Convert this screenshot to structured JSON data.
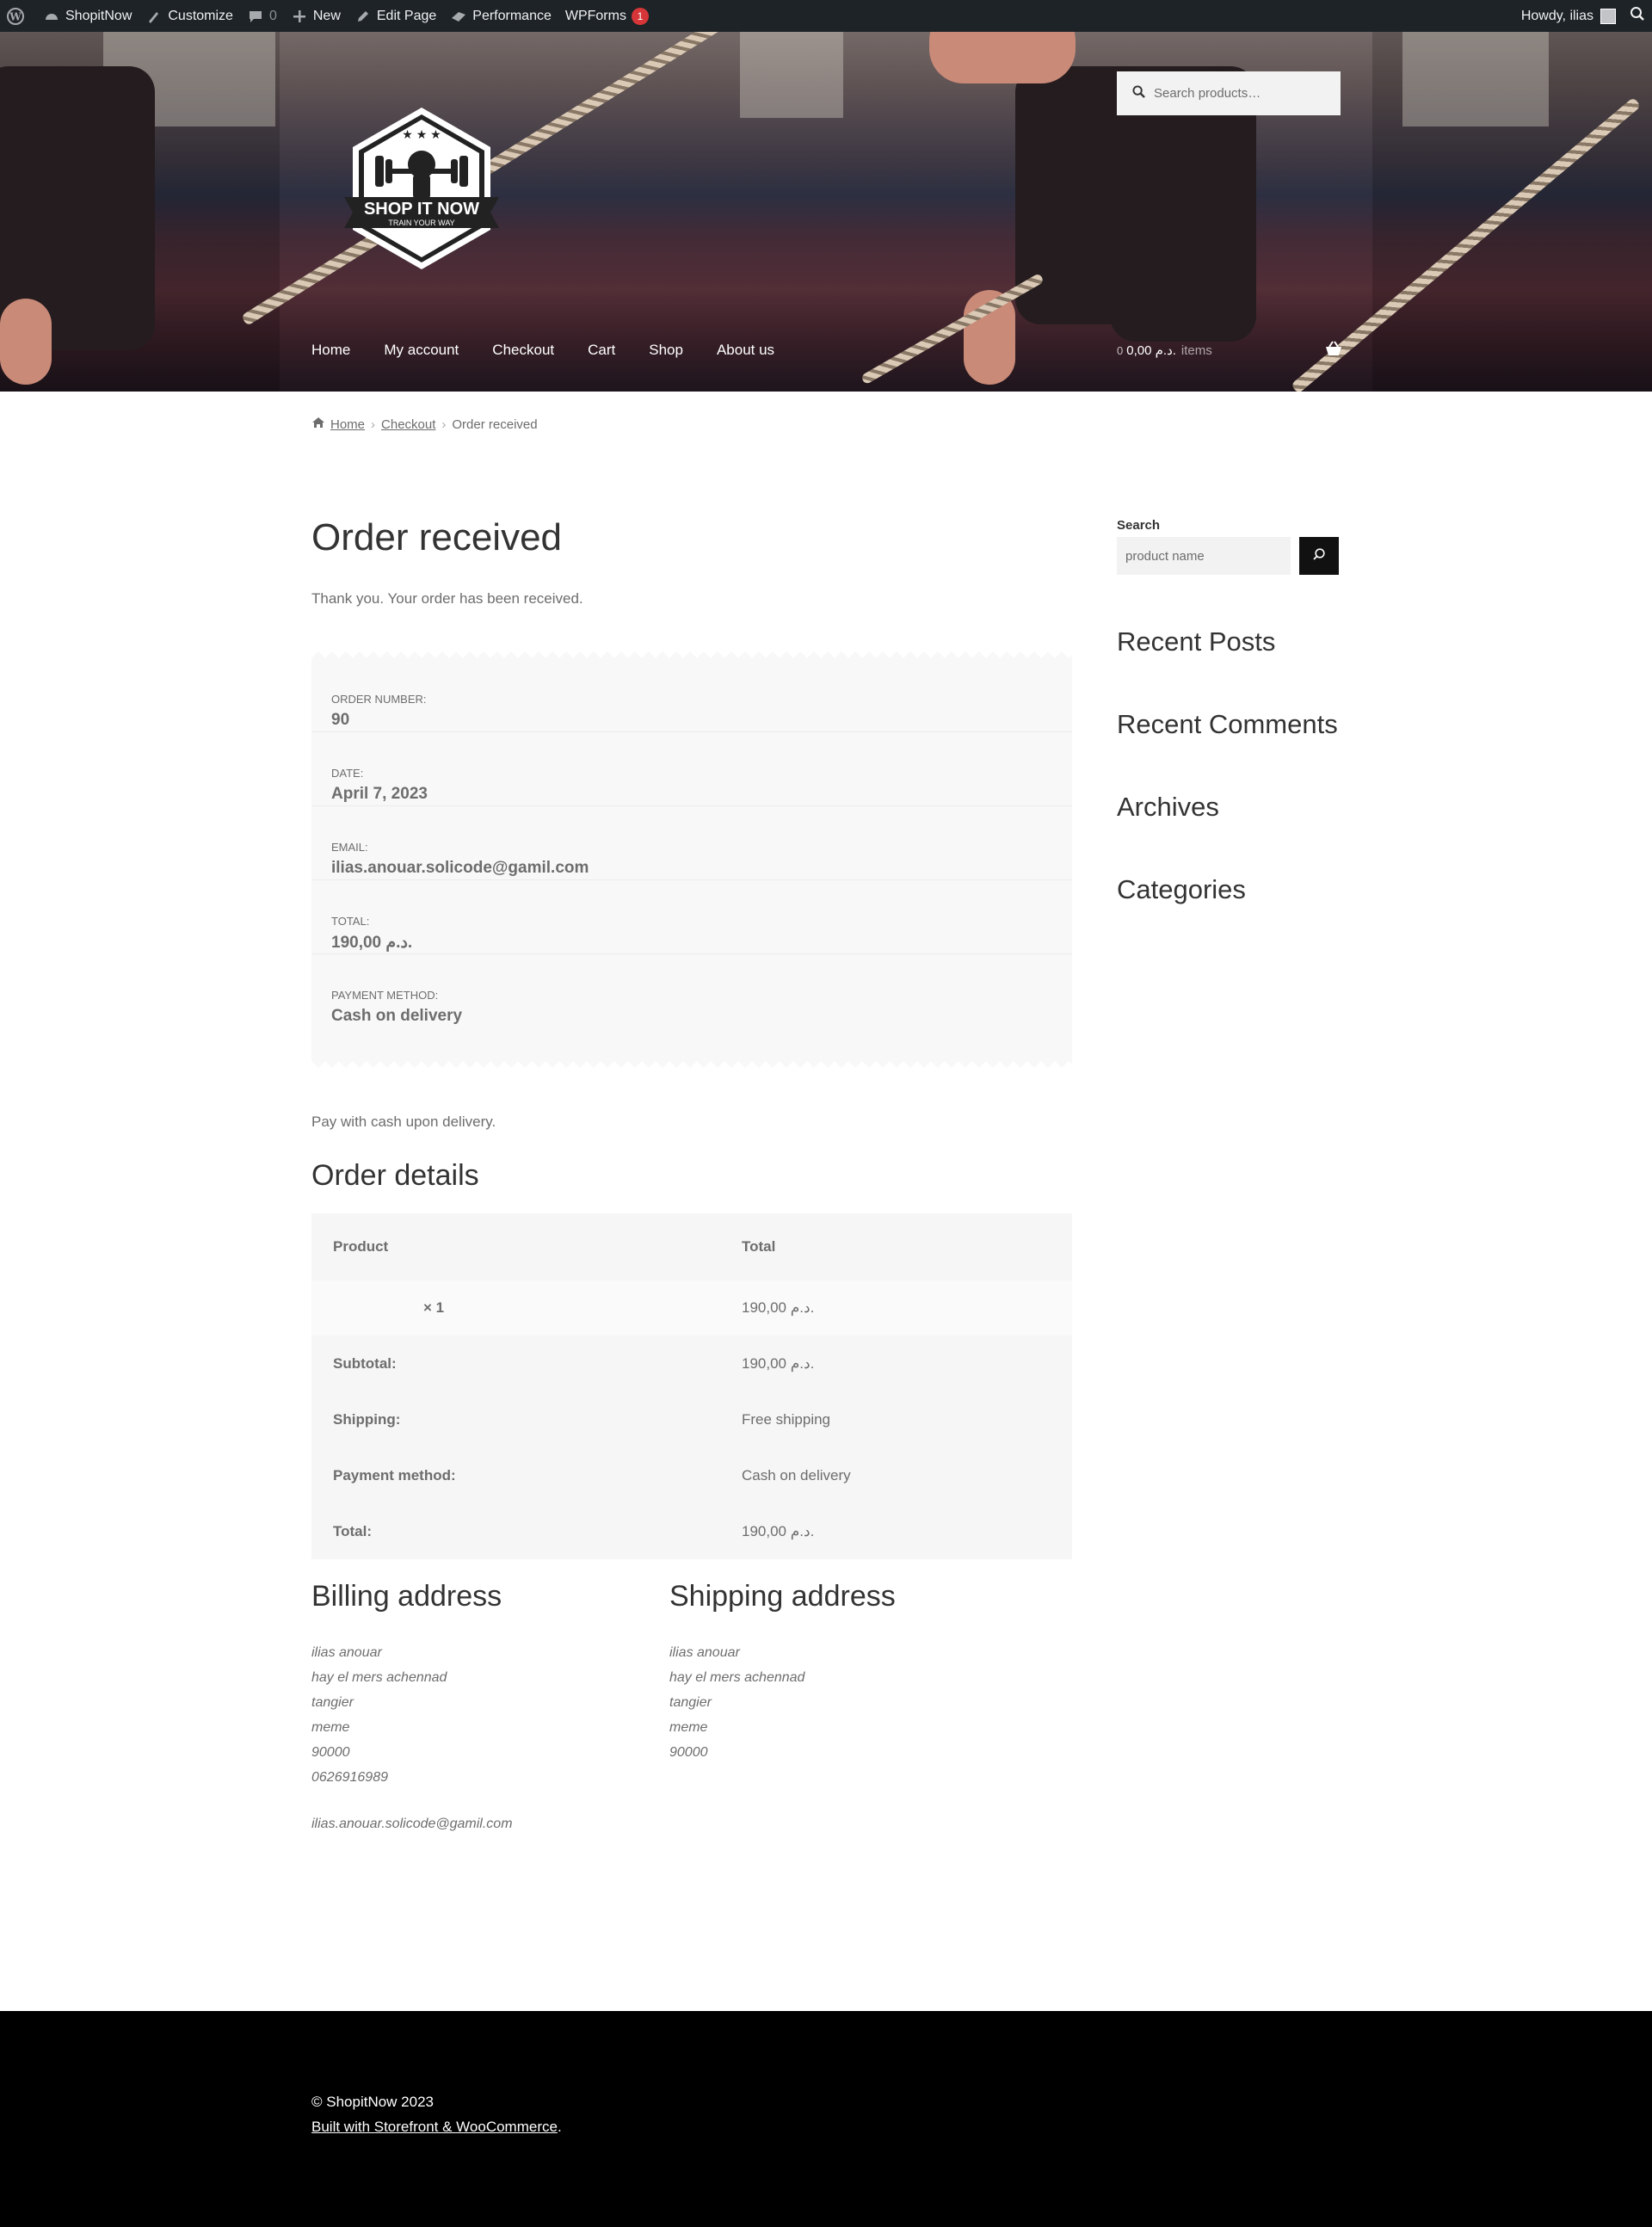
{
  "admin_bar": {
    "site_name": "ShopitNow",
    "customize": "Customize",
    "comments_count": "0",
    "new": "New",
    "edit_page": "Edit Page",
    "performance": "Performance",
    "wpforms": "WPForms",
    "wpforms_badge": "1",
    "howdy": "Howdy, ilias"
  },
  "header": {
    "logo_title": "SHOP IT NOW",
    "logo_tagline": "TRAIN YOUR WAY",
    "search_placeholder": "Search products…",
    "nav": [
      "Home",
      "My account",
      "Checkout",
      "Cart",
      "Shop",
      "About us"
    ],
    "cart": {
      "count": "0",
      "amount": "0,00 د.م.",
      "items_label": "items"
    }
  },
  "breadcrumb": {
    "home": "Home",
    "checkout": "Checkout",
    "current": "Order received"
  },
  "main": {
    "title": "Order received",
    "thank_you": "Thank you. Your order has been received.",
    "overview": [
      {
        "label": "Order number:",
        "value": "90"
      },
      {
        "label": "Date:",
        "value": "April 7, 2023"
      },
      {
        "label": "Email:",
        "value": "ilias.anouar.solicode@gamil.com"
      },
      {
        "label": "Total:",
        "value": "190,00 د.م."
      },
      {
        "label": "Payment method:",
        "value": "Cash on delivery"
      }
    ],
    "payment_note": "Pay with cash upon delivery.",
    "order_details_title": "Order details",
    "details_table": {
      "headers": [
        "Product",
        "Total"
      ],
      "item": {
        "qty": "× 1",
        "total": "190,00 د.م."
      },
      "totals": [
        {
          "label": "Subtotal:",
          "value": "190,00 د.م."
        },
        {
          "label": "Shipping:",
          "value": "Free shipping"
        },
        {
          "label": "Payment method:",
          "value": "Cash on delivery"
        },
        {
          "label": "Total:",
          "value": "190,00 د.م."
        }
      ]
    },
    "billing": {
      "title": "Billing address",
      "lines": [
        "ilias anouar",
        "hay el mers achennad",
        "tangier",
        "meme",
        "90000",
        "0626916989"
      ],
      "email": "ilias.anouar.solicode@gamil.com"
    },
    "shipping": {
      "title": "Shipping address",
      "lines": [
        "ilias anouar",
        "hay el mers achennad",
        "tangier",
        "meme",
        "90000"
      ]
    }
  },
  "sidebar": {
    "search_label": "Search",
    "search_placeholder": "product name",
    "widgets": [
      "Recent Posts",
      "Recent Comments",
      "Archives",
      "Categories"
    ]
  },
  "footer": {
    "copyright": "© ShopitNow 2023",
    "built_with": "Built with Storefront & WooCommerce",
    "built_suffix": "."
  }
}
